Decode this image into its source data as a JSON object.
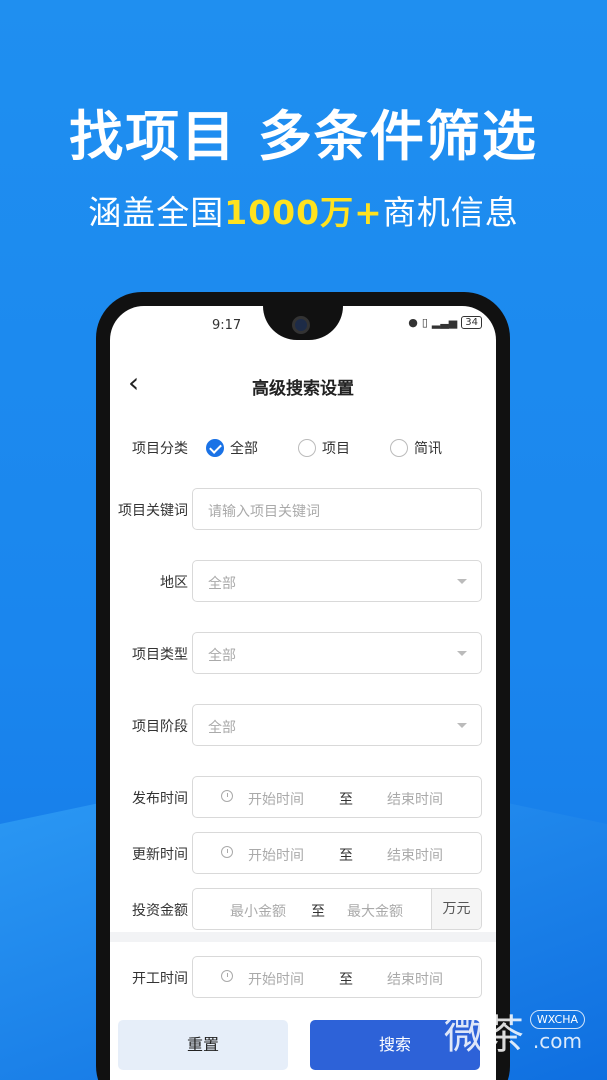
{
  "promo": {
    "headline": "找项目 多条件筛选",
    "sub_prefix": "涵盖全国",
    "sub_highlight": "1000万+",
    "sub_suffix": "商机信息"
  },
  "status": {
    "time": "9:17",
    "battery": "34"
  },
  "nav": {
    "title": "高级搜索设置"
  },
  "form": {
    "category": {
      "label": "项目分类",
      "options": [
        "全部",
        "项目",
        "简讯"
      ],
      "selected": "全部"
    },
    "keyword": {
      "label": "项目关键词",
      "placeholder": "请输入项目关键词"
    },
    "region": {
      "label": "地区",
      "value": "全部"
    },
    "type": {
      "label": "项目类型",
      "value": "全部"
    },
    "stage": {
      "label": "项目阶段",
      "value": "全部"
    },
    "publish": {
      "label": "发布时间",
      "start": "开始时间",
      "to": "至",
      "end": "结束时间"
    },
    "update": {
      "label": "更新时间",
      "start": "开始时间",
      "to": "至",
      "end": "结束时间"
    },
    "amount": {
      "label": "投资金额",
      "min": "最小金额",
      "to": "至",
      "max": "最大金额",
      "unit": "万元"
    },
    "construction": {
      "label": "开工时间",
      "start": "开始时间",
      "to": "至",
      "end": "结束时间"
    }
  },
  "actions": {
    "reset": "重置",
    "search": "搜索"
  },
  "watermark": {
    "text": "微茶",
    "badge": "WXCHA",
    "suffix": ".com"
  }
}
